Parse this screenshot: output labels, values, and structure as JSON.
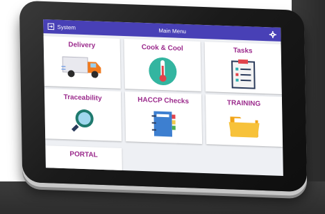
{
  "header": {
    "system_label": "System",
    "title": "Main Menu"
  },
  "menu": [
    {
      "label": "Delivery",
      "icon": "delivery-truck-icon"
    },
    {
      "label": "Cook & Cool",
      "icon": "thermometer-icon"
    },
    {
      "label": "Tasks",
      "icon": "checklist-icon"
    },
    {
      "label": "Traceability",
      "icon": "magnifier-icon"
    },
    {
      "label": "HACCP Checks",
      "icon": "binder-icon"
    },
    {
      "label": "TRAINING",
      "icon": "folder-icon"
    }
  ],
  "portal": {
    "label": "PORTAL"
  },
  "colors": {
    "header_bg": "#4840b6",
    "tile_label": "#9b2a8c"
  }
}
